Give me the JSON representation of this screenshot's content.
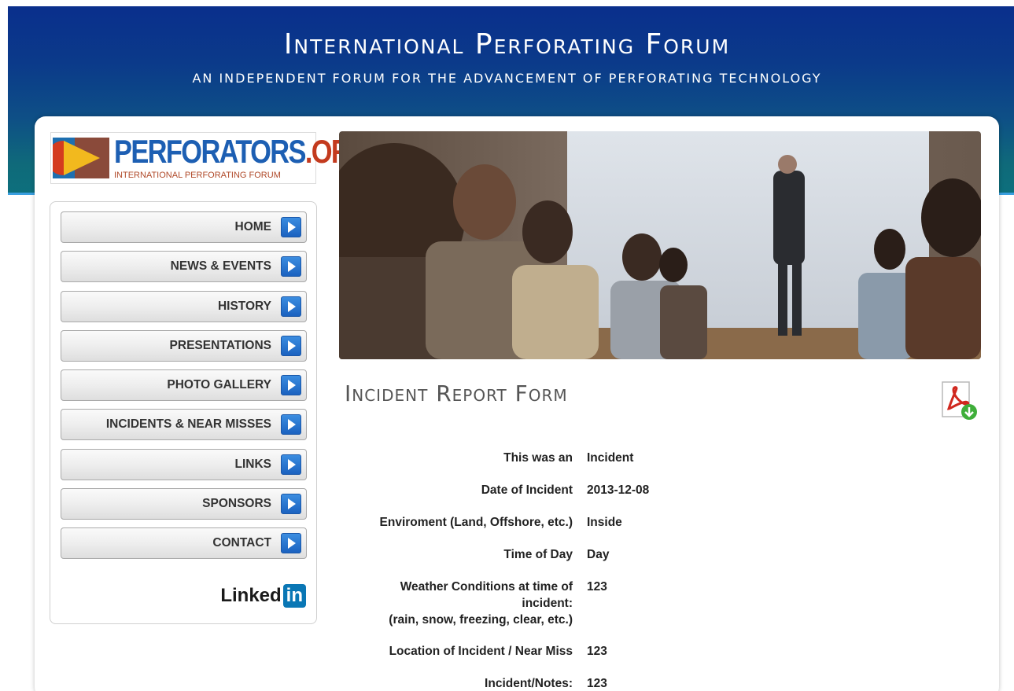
{
  "header": {
    "title": "International Perforating Forum",
    "subtitle": "AN INDEPENDENT FORUM FOR THE ADVANCEMENT OF PERFORATING TECHNOLOGY"
  },
  "logo": {
    "name_main": "PERFORATORS",
    "name_suffix": ".ORG",
    "tagline": "INTERNATIONAL PERFORATING FORUM"
  },
  "nav": {
    "items": [
      {
        "label": "HOME"
      },
      {
        "label": "NEWS & EVENTS"
      },
      {
        "label": "HISTORY"
      },
      {
        "label": "PRESENTATIONS"
      },
      {
        "label": "PHOTO GALLERY"
      },
      {
        "label": "INCIDENTS & NEAR MISSES"
      },
      {
        "label": "LINKS"
      },
      {
        "label": "SPONSORS"
      },
      {
        "label": "CONTACT"
      }
    ],
    "linkedin_word": "Linked",
    "linkedin_in": "in"
  },
  "page": {
    "title": "Incident Report Form",
    "pdf_icon": "pdf-download-icon"
  },
  "form": {
    "rows": [
      {
        "label": "This was an",
        "value": "Incident"
      },
      {
        "label": "Date of Incident",
        "value": "2013-12-08"
      },
      {
        "label": "Enviroment (Land, Offshore, etc.)",
        "value": "Inside"
      },
      {
        "label": "Time of Day",
        "value": "Day"
      },
      {
        "label": "Weather Conditions at time of incident:",
        "label2": "(rain, snow, freezing, clear, etc.)",
        "value": "123"
      },
      {
        "label": "Location of Incident / Near Miss",
        "value": "123"
      },
      {
        "label": "Incident/Notes:",
        "value": "123"
      }
    ]
  },
  "colors": {
    "header_top": "#0a2f8c",
    "header_bottom": "#0d6f7c",
    "nav_arrow": "#1b62c0",
    "logo_blue": "#1d5fb3",
    "logo_red": "#c33a1e"
  }
}
